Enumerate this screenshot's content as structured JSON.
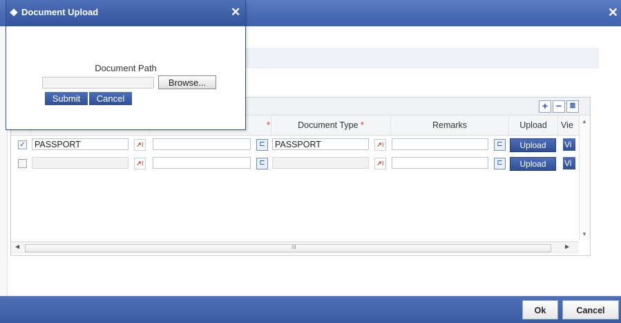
{
  "window": {
    "close_glyph": "✕"
  },
  "grid": {
    "toolbar": {
      "add_icon": "+",
      "remove_icon": "−",
      "view_icon": "≣"
    },
    "columns": [
      {
        "label": "",
        "required": false
      },
      {
        "label": "",
        "required": true
      },
      {
        "label": "Document Type",
        "required": true
      },
      {
        "label": "Remarks",
        "required": false
      },
      {
        "label": "Upload",
        "required": false
      },
      {
        "label": "Vie",
        "required": false
      }
    ],
    "required_marker": "*",
    "rows": [
      {
        "checked": true,
        "document_category": "PASSPORT",
        "reference": "",
        "document_type": "PASSPORT",
        "remarks": "",
        "upload_label": "Upload",
        "view_label": "Vi"
      },
      {
        "checked": false,
        "document_category": "",
        "reference": "",
        "document_type": "",
        "remarks": "",
        "upload_label": "Upload",
        "view_label": "Vi"
      }
    ],
    "hscroll_grip": "III"
  },
  "footer": {
    "ok_label": "Ok",
    "cancel_label": "Cancel"
  },
  "popup": {
    "title": "Document Upload",
    "close_glyph": "✕",
    "path_label": "Document Path",
    "path_value": "",
    "browse_label": "Browse...",
    "submit_label": "Submit",
    "cancel_label": "Cancel"
  },
  "colors": {
    "title_bar": "#3f62ad",
    "button_blue": "#2f4f95",
    "required": "#e0303b"
  }
}
